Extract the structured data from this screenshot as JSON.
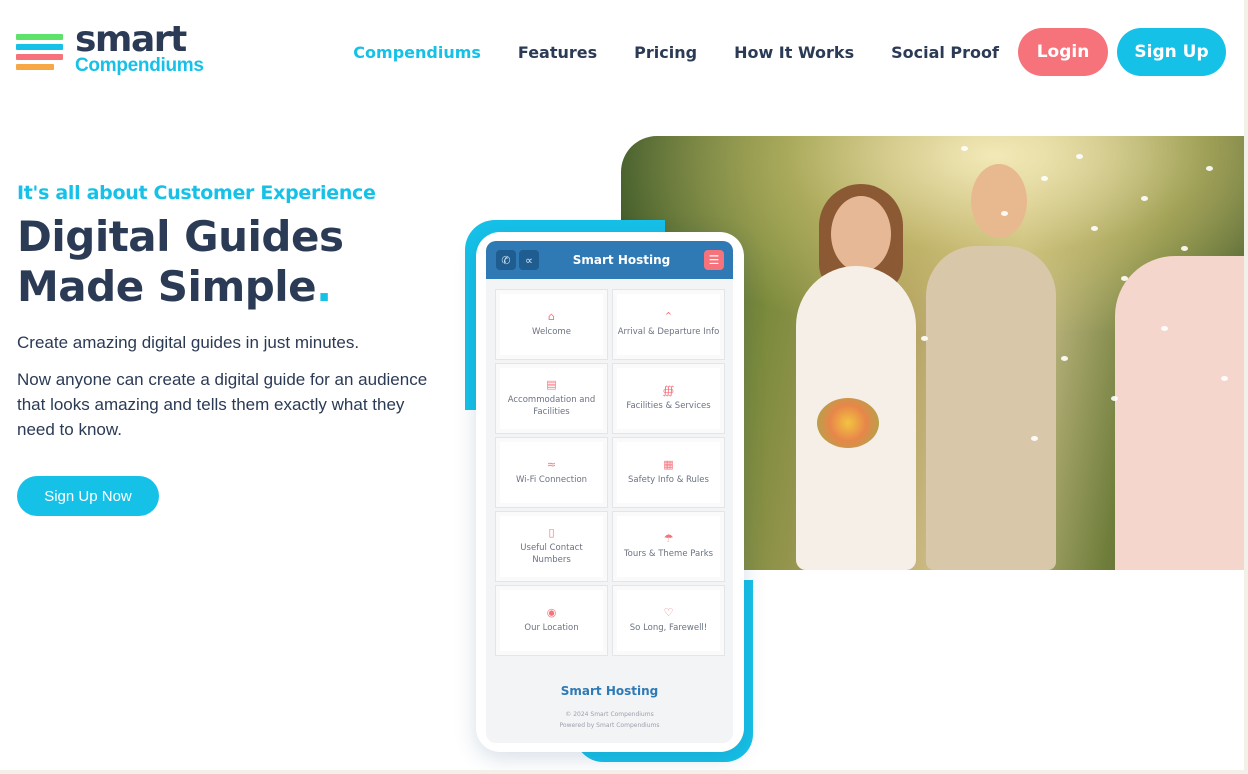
{
  "brand": {
    "logo_word": "smart",
    "logo_sub": "Compendiums",
    "logo_bar_colors": [
      "#5ee36a",
      "#16c1e8",
      "#f7737c",
      "#f7a845"
    ]
  },
  "nav": {
    "items": [
      {
        "label": "Compendiums",
        "active": true
      },
      {
        "label": "Features",
        "active": false
      },
      {
        "label": "Pricing",
        "active": false
      },
      {
        "label": "How It Works",
        "active": false
      },
      {
        "label": "Social Proof",
        "active": false
      }
    ],
    "login_label": "Login",
    "signup_label": "Sign Up"
  },
  "hero": {
    "tagline": "It's all about Customer Experience",
    "headline_line1": "Digital Guides",
    "headline_line2": "Made Simple",
    "headline_dot": ".",
    "paragraph1": "Create amazing digital guides in just minutes.",
    "paragraph2": "Now anyone can create a digital guide for an audience that looks amazing and tells them exactly what they need to know.",
    "cta_label": "Sign Up Now"
  },
  "phone": {
    "app_title": "Smart Hosting",
    "icons": [
      "phone-icon",
      "share-icon",
      "menu-icon"
    ],
    "tiles": [
      {
        "label": "Welcome",
        "icon": "home-icon"
      },
      {
        "label": "Arrival & Departure Info",
        "icon": "house-outline-icon"
      },
      {
        "label": "Accommodation and Facilities",
        "icon": "bed-icon"
      },
      {
        "label": "Facilities & Services",
        "icon": "concierge-icon"
      },
      {
        "label": "Wi-Fi Connection",
        "icon": "wifi-icon"
      },
      {
        "label": "Safety Info & Rules",
        "icon": "rules-icon"
      },
      {
        "label": "Useful Contact Numbers",
        "icon": "contact-phone-icon"
      },
      {
        "label": "Tours & Theme Parks",
        "icon": "umbrella-icon"
      },
      {
        "label": "Our Location",
        "icon": "location-pin-icon"
      },
      {
        "label": "So Long, Farewell!",
        "icon": "heart-icon"
      }
    ],
    "footer_title": "Smart Hosting",
    "footer_copyright": "© 2024 Smart Compendiums",
    "footer_powered": "Powered by Smart Compendiums"
  },
  "colors": {
    "accent": "#16c1e8",
    "login": "#f7737c",
    "text_dark": "#2b3a55",
    "app_blue": "#2f7ab5"
  }
}
